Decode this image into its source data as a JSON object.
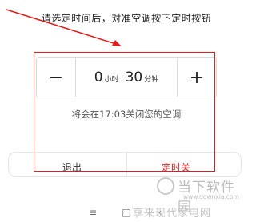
{
  "instruction": "请选定时间后，对准空调按下定时按钮",
  "timer": {
    "minus_label": "−",
    "plus_label": "+",
    "hours_value": "0",
    "hours_unit": "小时",
    "minutes_value": "30",
    "minutes_unit": "分钟"
  },
  "note": "将会在17:03关闭您的空调",
  "buttons": {
    "exit_label": "退出",
    "timer_off_label": "定时关"
  },
  "navbar": {
    "menu_icon": "≡",
    "home_icon": "□",
    "back_icon": "‹"
  },
  "watermark": {
    "title": "当下软件园",
    "url": "www.downxia.com",
    "subtitle": "享来现代家电网"
  },
  "colors": {
    "accent": "#e02020",
    "highlight_border": "#e21b1b",
    "text": "#222222",
    "border": "#dadada"
  },
  "icons": [
    "arrow-annotation",
    "menu-icon",
    "home-icon",
    "back-icon",
    "watermark-logo-icon"
  ]
}
